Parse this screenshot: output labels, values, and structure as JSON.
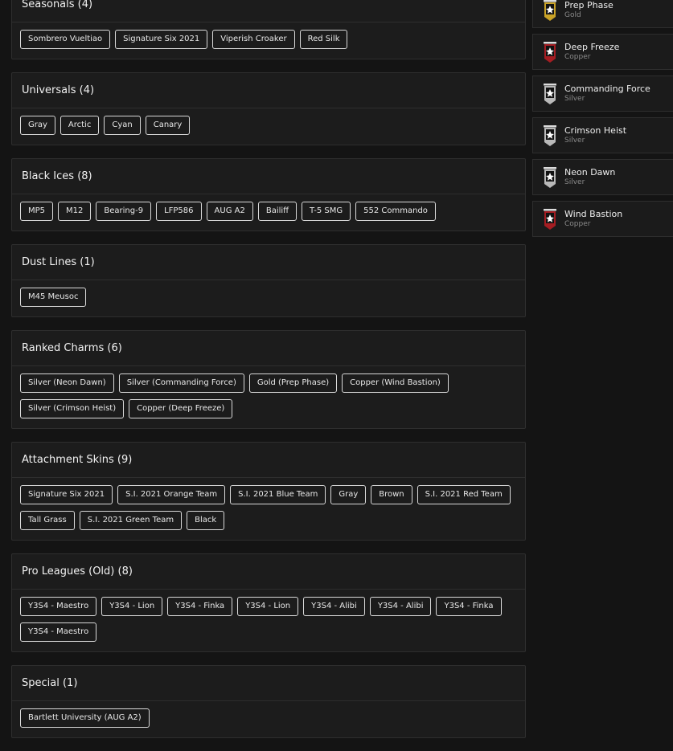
{
  "sections": [
    {
      "title": "Seasonals (4)",
      "items": [
        "Sombrero Vueltiao",
        "Signature Six 2021",
        "Viperish Croaker",
        "Red Silk"
      ]
    },
    {
      "title": "Universals (4)",
      "items": [
        "Gray",
        "Arctic",
        "Cyan",
        "Canary"
      ]
    },
    {
      "title": "Black Ices (8)",
      "items": [
        "MP5",
        "M12",
        "Bearing-9",
        "LFP586",
        "AUG A2",
        "Bailiff",
        "T-5 SMG",
        "552 Commando"
      ]
    },
    {
      "title": "Dust Lines (1)",
      "items": [
        "M45 Meusoc"
      ]
    },
    {
      "title": "Ranked Charms (6)",
      "items": [
        "Silver (Neon Dawn)",
        "Silver (Commanding Force)",
        "Gold (Prep Phase)",
        "Copper (Wind Bastion)",
        "Silver (Crimson Heist)",
        "Copper (Deep Freeze)"
      ]
    },
    {
      "title": "Attachment Skins (9)",
      "items": [
        "Signature Six 2021",
        "S.I. 2021 Orange Team",
        "S.I. 2021 Blue Team",
        "Gray",
        "Brown",
        "S.I. 2021 Red Team",
        "Tall Grass",
        "S.I. 2021 Green Team",
        "Black"
      ]
    },
    {
      "title": "Pro Leagues (Old) (8)",
      "items": [
        "Y3S4 - Maestro",
        "Y3S4 - Lion",
        "Y3S4 - Finka",
        "Y3S4 - Lion",
        "Y3S4 - Alibi",
        "Y3S4 - Alibi",
        "Y3S4 - Finka",
        "Y3S4 - Maestro"
      ]
    },
    {
      "title": "Special (1)",
      "items": [
        "Bartlett University (AUG A2)"
      ]
    }
  ],
  "charms": [
    {
      "name": "Prep Phase",
      "tier": "Gold",
      "color": "#c9a227",
      "icon": "gold-rank-badge-icon"
    },
    {
      "name": "Deep Freeze",
      "tier": "Copper",
      "color": "#a41d22",
      "icon": "copper-rank-badge-icon"
    },
    {
      "name": "Commanding Force",
      "tier": "Silver",
      "color": "#b9b9b9",
      "icon": "silver-rank-badge-icon"
    },
    {
      "name": "Crimson Heist",
      "tier": "Silver",
      "color": "#b9b9b9",
      "icon": "silver-rank-badge-icon"
    },
    {
      "name": "Neon Dawn",
      "tier": "Silver",
      "color": "#b9b9b9",
      "icon": "silver-rank-badge-icon"
    },
    {
      "name": "Wind Bastion",
      "tier": "Copper",
      "color": "#a41d22",
      "icon": "copper-rank-badge-icon"
    }
  ]
}
